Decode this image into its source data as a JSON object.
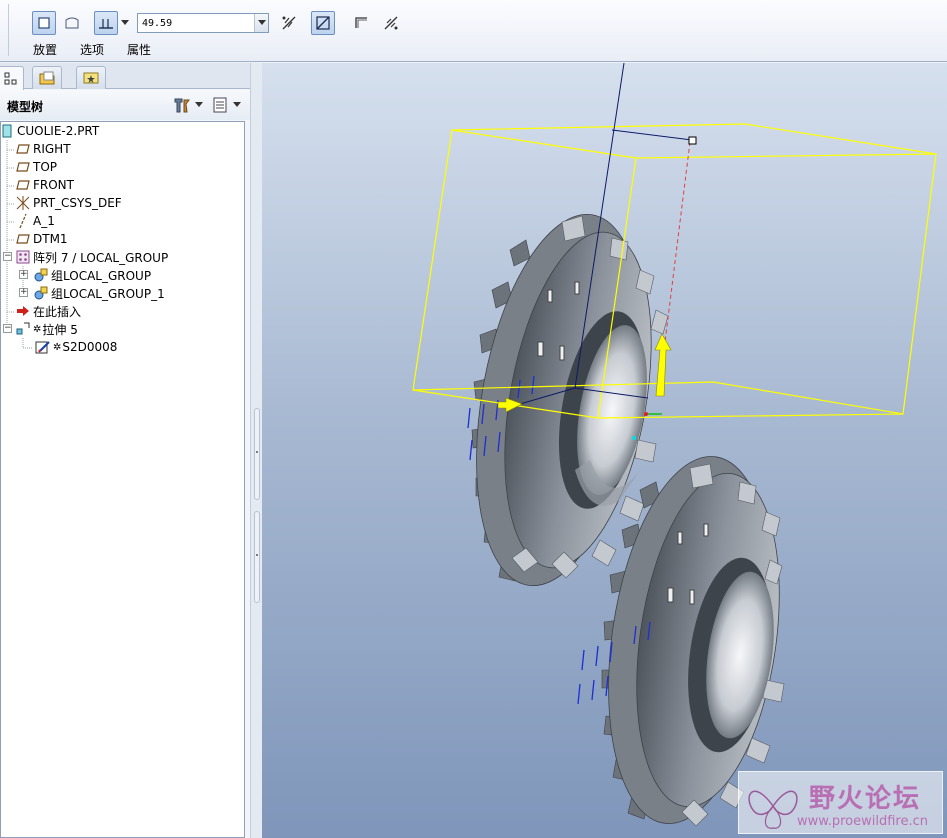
{
  "dashboard": {
    "depth_value": "49.59",
    "tabs": {
      "placement": "放置",
      "options": "选项",
      "properties": "属性"
    }
  },
  "navigator": {
    "panel_title": "模型树",
    "tree": {
      "root": "CUOLIE-2.PRT",
      "items": [
        {
          "label": "RIGHT",
          "icon": "datum-plane-icon"
        },
        {
          "label": "TOP",
          "icon": "datum-plane-icon"
        },
        {
          "label": "FRONT",
          "icon": "datum-plane-icon"
        },
        {
          "label": "PRT_CSYS_DEF",
          "icon": "coordinate-system-icon"
        },
        {
          "label": "A_1",
          "icon": "datum-axis-icon"
        },
        {
          "label": "DTM1",
          "icon": "datum-plane-icon"
        },
        {
          "label": "阵列 7 / LOCAL_GROUP",
          "icon": "pattern-icon"
        },
        {
          "label": "组LOCAL_GROUP",
          "icon": "group-icon"
        },
        {
          "label": "组LOCAL_GROUP_1",
          "icon": "group-icon"
        },
        {
          "label": "在此插入",
          "icon": "insert-here-arrow-icon"
        },
        {
          "label": "拉伸 5",
          "icon": "extrude-icon",
          "marker": "✲"
        },
        {
          "label": "S2D0008",
          "icon": "sketch-icon",
          "marker": "✲"
        }
      ]
    }
  },
  "watermark": {
    "title": "野火论坛",
    "url": "www.proewildfire.cn"
  },
  "colors": {
    "graphics_top": "#d6e0ee",
    "graphics_bottom": "#7f96ba",
    "bounding_box": "#ffff00",
    "watermark": "#b86fb3"
  }
}
